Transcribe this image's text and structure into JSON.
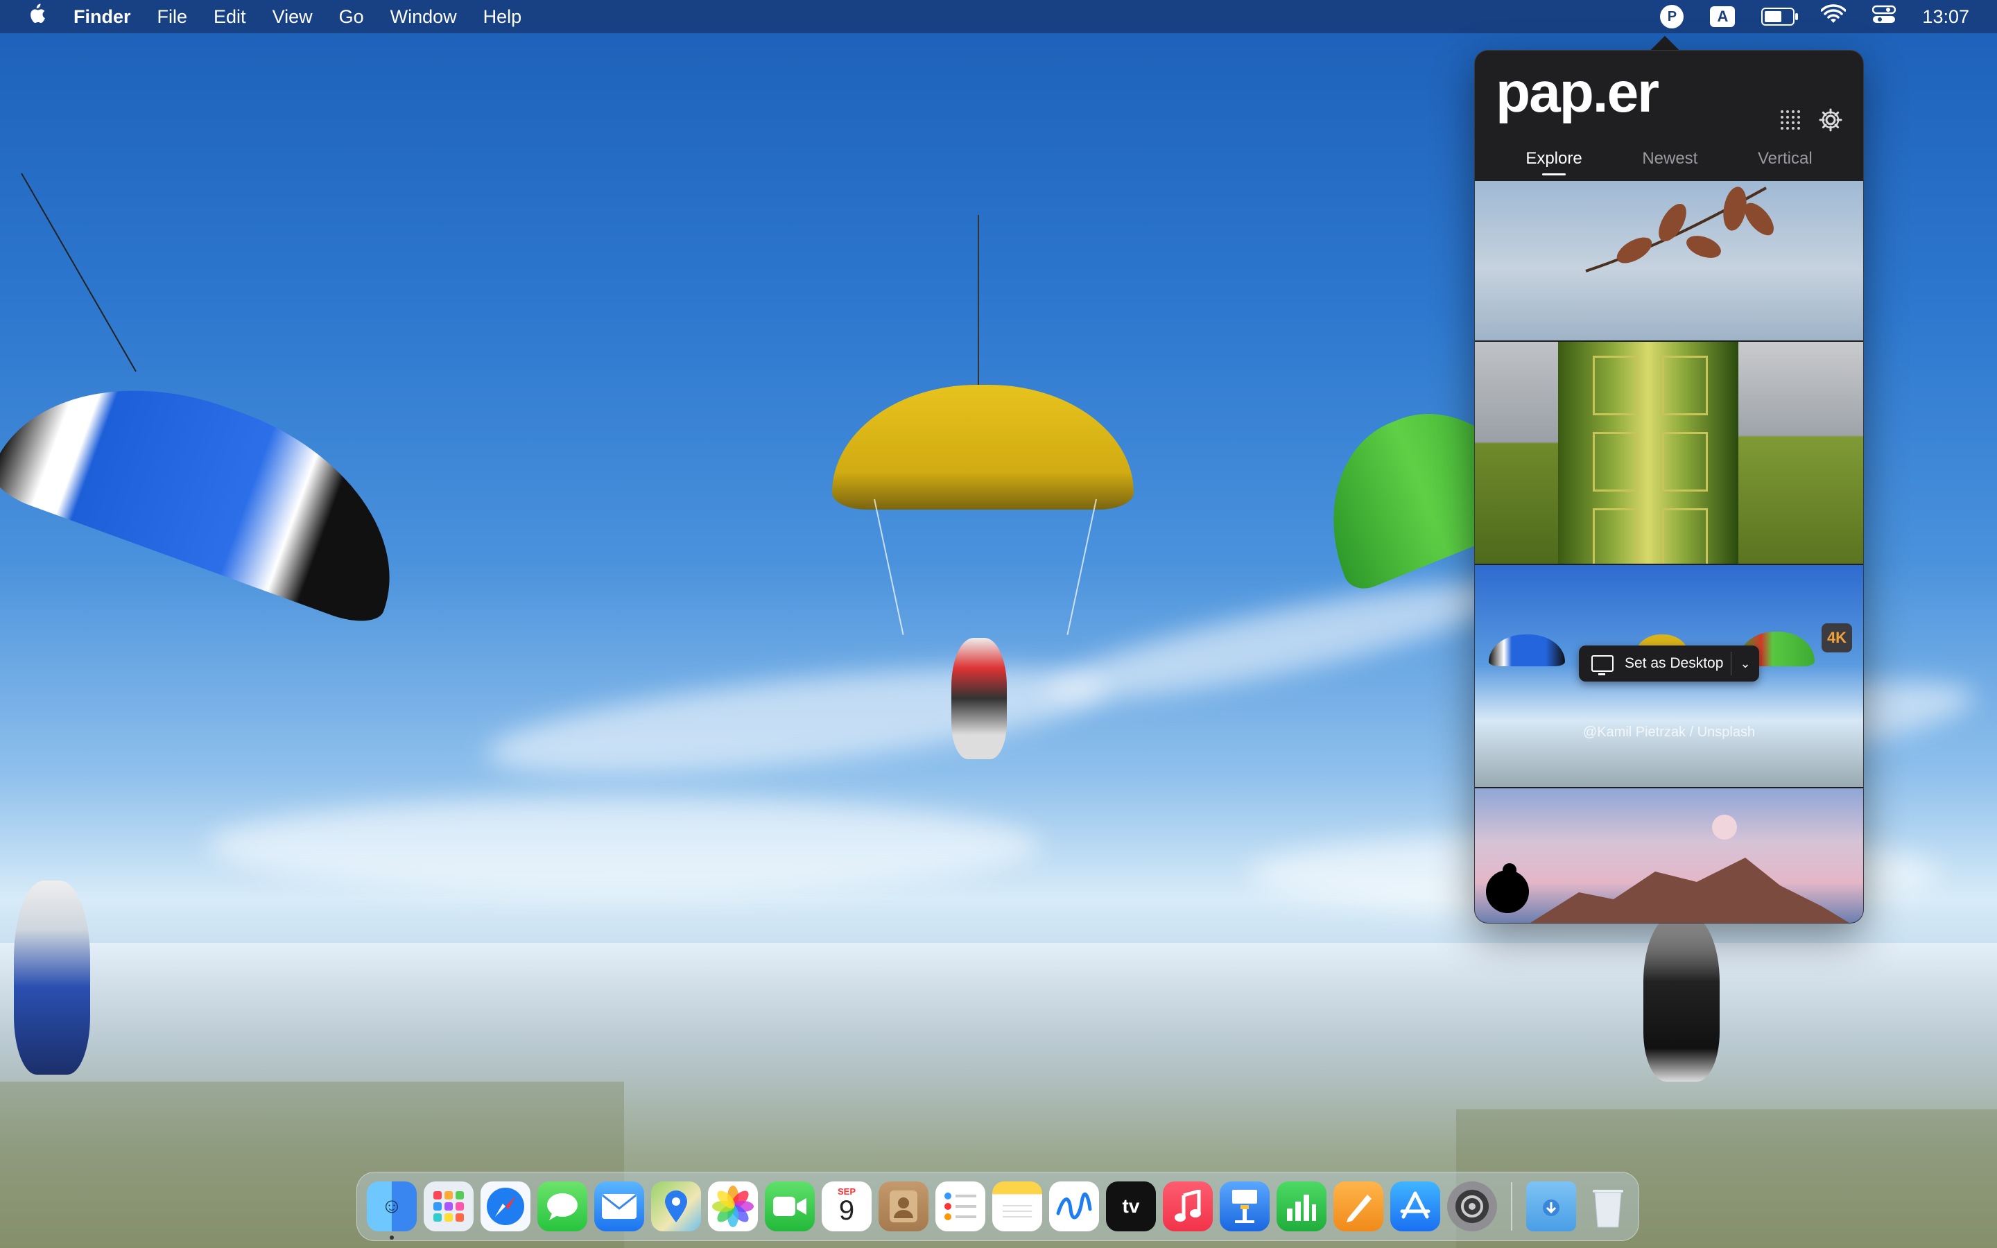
{
  "menubar": {
    "app_name": "Finder",
    "menus": [
      "File",
      "Edit",
      "View",
      "Go",
      "Window",
      "Help"
    ],
    "status": {
      "paper_icon_letter": "P",
      "input_source": "A",
      "clock": "13:07"
    }
  },
  "popover": {
    "logo": "pap.er",
    "tabs": [
      "Explore",
      "Newest",
      "Vertical"
    ],
    "active_tab": "Explore",
    "badge": "4K",
    "set_desktop_label": "Set as Desktop",
    "chevron": "⌄",
    "credit": "@Kamil Pietrzak / Unsplash"
  },
  "dock": {
    "calendar_month": "SEP",
    "calendar_day": "9",
    "tv_label": "tv",
    "apps": [
      "finder",
      "launchpad",
      "safari",
      "messages",
      "mail",
      "maps",
      "photos",
      "facetime",
      "calendar",
      "contacts",
      "reminders",
      "notes",
      "freeform",
      "tv",
      "music",
      "keynote",
      "numbers",
      "pages",
      "app-store",
      "system-settings",
      "downloads",
      "trash"
    ]
  }
}
